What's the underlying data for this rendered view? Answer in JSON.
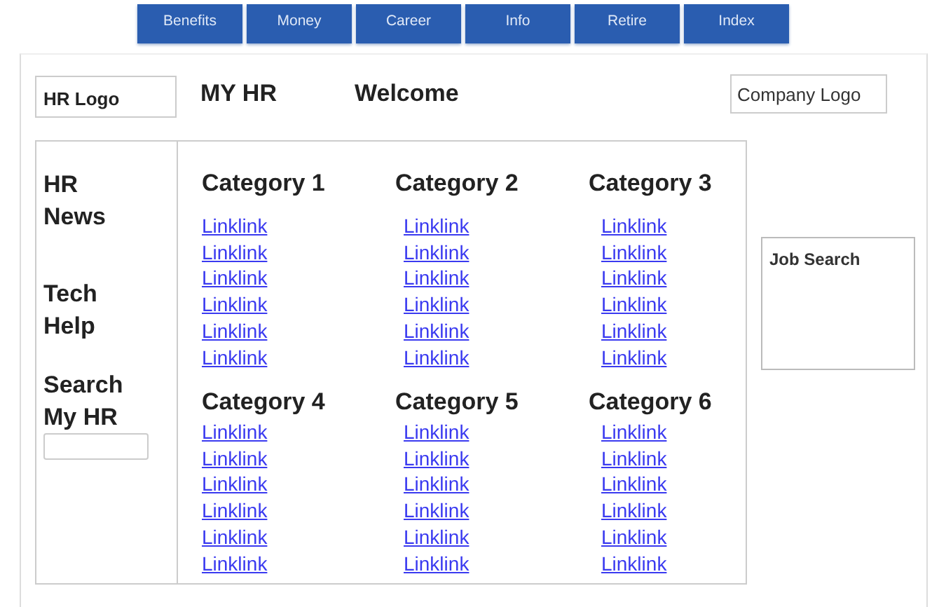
{
  "nav_tabs": [
    {
      "label": "Benefits"
    },
    {
      "label": "Money"
    },
    {
      "label": "Career"
    },
    {
      "label": "Info"
    },
    {
      "label": "Retire"
    },
    {
      "label": "Index"
    }
  ],
  "header": {
    "hr_logo": "HR Logo",
    "title": "MY HR",
    "welcome": "Welcome",
    "company_logo": "Company Logo"
  },
  "sidebar": {
    "sections": [
      {
        "label": "HR News"
      },
      {
        "label": "Tech Help"
      },
      {
        "label": "Search My HR"
      }
    ]
  },
  "categories": [
    {
      "title": "Category 1",
      "links": [
        "Linklink",
        "Linklink",
        "Linklink",
        "Linklink",
        "Linklink",
        "Linklink"
      ]
    },
    {
      "title": "Category 2",
      "links": [
        "Linklink",
        "Linklink",
        "Linklink",
        "Linklink",
        "Linklink",
        "Linklink"
      ]
    },
    {
      "title": "Category 3",
      "links": [
        "Linklink",
        "Linklink",
        "Linklink",
        "Linklink",
        "Linklink",
        "Linklink"
      ]
    },
    {
      "title": "Category 4",
      "links": [
        "Linklink",
        "Linklink",
        "Linklink",
        "Linklink",
        "Linklink",
        "Linklink"
      ]
    },
    {
      "title": "Category 5",
      "links": [
        "Linklink",
        "Linklink",
        "Linklink",
        "Linklink",
        "Linklink",
        "Linklink"
      ]
    },
    {
      "title": "Category 6",
      "links": [
        "Linklink",
        "Linklink",
        "Linklink",
        "Linklink",
        "Linklink",
        "Linklink"
      ]
    }
  ],
  "job_search": {
    "title": "Job Search"
  }
}
